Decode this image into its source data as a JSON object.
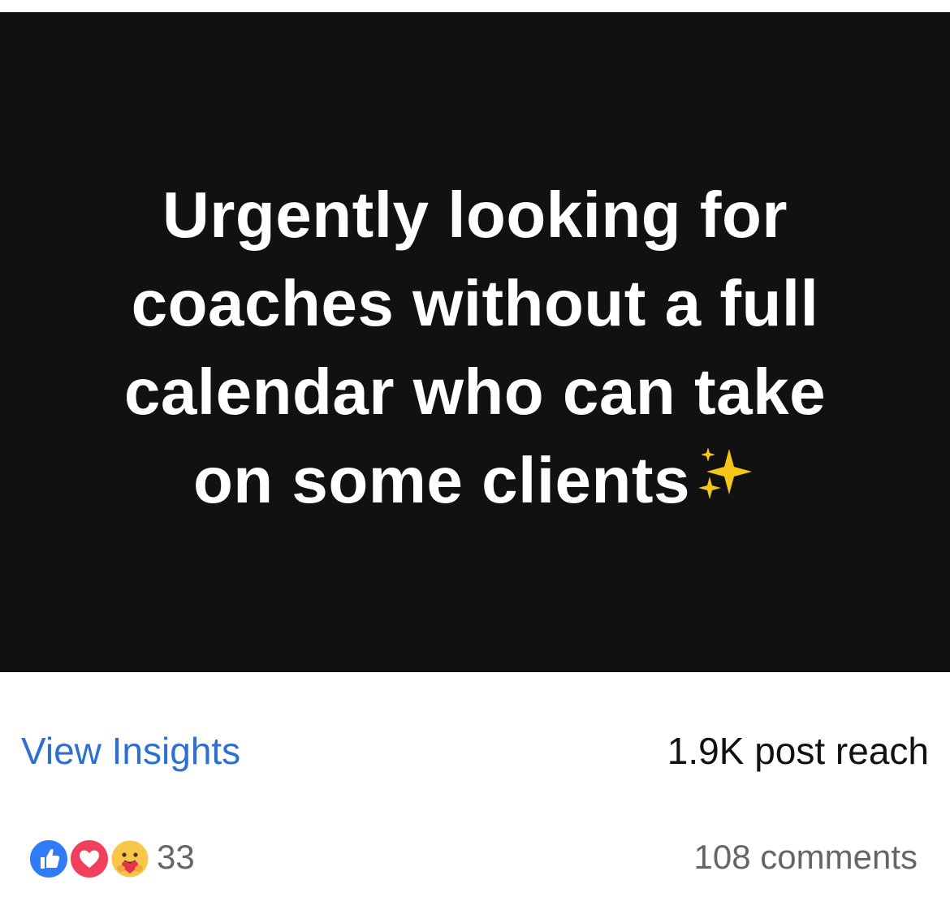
{
  "post": {
    "image_lines": [
      "Urgently looking for",
      "coaches without a full",
      "calendar who can take",
      "on some clients"
    ],
    "image_emoji_icon": "sparkles-icon",
    "image_background": "#111111",
    "image_text_color": "#ffffff"
  },
  "insights": {
    "view_label": "View Insights",
    "reach_text": "1.9K post reach",
    "link_color": "#2d6fd2"
  },
  "engagement": {
    "reaction_icons": [
      "like-icon",
      "love-icon",
      "care-icon"
    ],
    "reaction_count": "33",
    "comments_text": "108 comments"
  }
}
